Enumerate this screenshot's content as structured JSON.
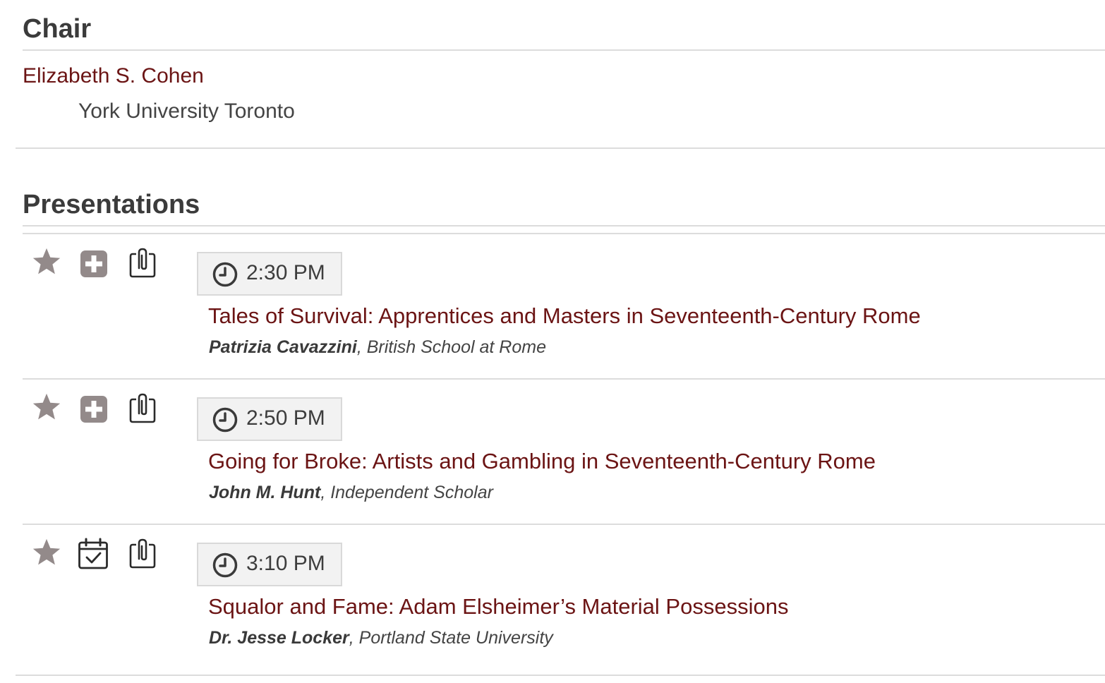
{
  "chair": {
    "heading": "Chair",
    "name": "Elizabeth S. Cohen",
    "affiliation": "York University Toronto"
  },
  "presentations": {
    "heading": "Presentations",
    "items": [
      {
        "time": "2:30 PM",
        "title": "Tales of Survival: Apprentices and Masters in Seventeenth-Century Rome",
        "author": "Patrizia Cavazzini",
        "affiliation": ", British School at Rome",
        "schedule_icon": "plus-square-icon"
      },
      {
        "time": "2:50 PM",
        "title": "Going for Broke: Artists and Gambling in Seventeenth-Century Rome",
        "author": "John M. Hunt",
        "affiliation": ", Independent Scholar",
        "schedule_icon": "plus-square-icon"
      },
      {
        "time": "3:10 PM",
        "title": "Squalor and Fame: Adam Elsheimer’s Material Possessions",
        "author": "Dr. Jesse Locker",
        "affiliation": ", Portland State University",
        "schedule_icon": "calendar-check-icon"
      }
    ]
  },
  "colors": {
    "link": "#6b1414",
    "icon_gray": "#938a8a",
    "rule": "#dcdcdc",
    "time_box_bg": "#f2f2f2"
  }
}
